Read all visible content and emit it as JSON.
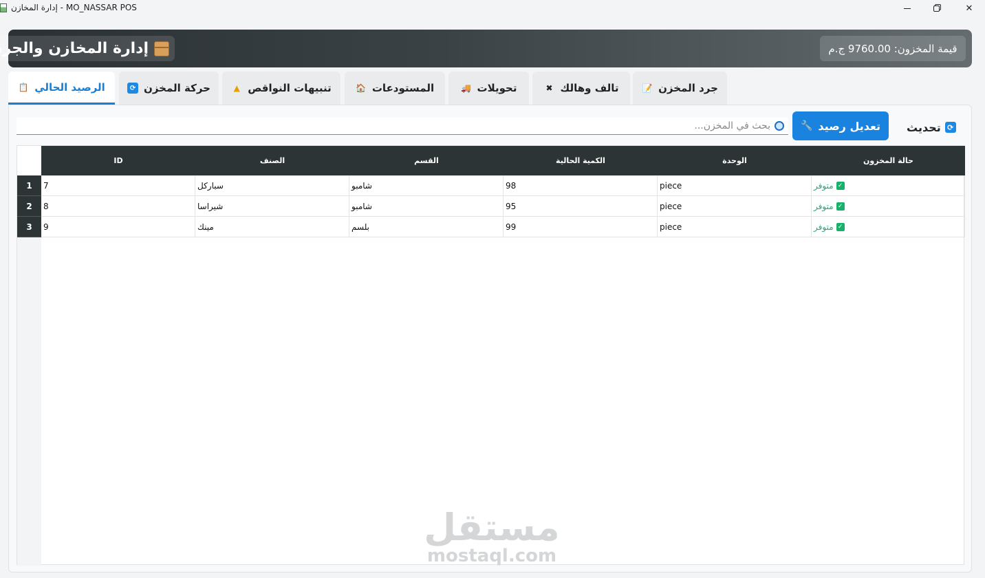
{
  "window": {
    "title": "إدارة المخازن - MO_NASSAR POS"
  },
  "header": {
    "title": "إدارة المخازن والجرد",
    "inventory_value_label": "قيمة المخزون: 9760.00 ج.م"
  },
  "tabs": [
    {
      "label": "جرد المخزن",
      "icon": "clipboard-pen-icon"
    },
    {
      "label": "تالف وهالك",
      "icon": "broken-icon"
    },
    {
      "label": "تحويلات",
      "icon": "truck-icon"
    },
    {
      "label": "المستودعات",
      "icon": "house-icon"
    },
    {
      "label": "تنبيهات النواقص",
      "icon": "warning-icon"
    },
    {
      "label": "حركة المخزن",
      "icon": "refresh-icon"
    },
    {
      "label": "الرصيد الحالي",
      "icon": "clipboard-icon",
      "active": true
    }
  ],
  "toolbar": {
    "refresh_label": "تحديث",
    "adjust_label": "تعديل رصيد",
    "search_placeholder": "بحث في المخزن..."
  },
  "table": {
    "columns": [
      "ID",
      "الصنف",
      "القسم",
      "الكمية الحالية",
      "الوحدة",
      "حالة المخزون"
    ],
    "rows": [
      {
        "num": "1",
        "id": "7",
        "item": "سباركل",
        "category": "شامبو",
        "qty": "98",
        "unit": "piece",
        "status": "متوفر"
      },
      {
        "num": "2",
        "id": "8",
        "item": "شيراسا",
        "category": "شامبو",
        "qty": "95",
        "unit": "piece",
        "status": "متوفر"
      },
      {
        "num": "3",
        "id": "9",
        "item": "مينك",
        "category": "بلسم",
        "qty": "99",
        "unit": "piece",
        "status": "متوفر"
      }
    ]
  },
  "watermark": {
    "arabic": "مستقل",
    "latin": "mostaql.com"
  },
  "colors": {
    "accent": "#1a83e0",
    "header_dark": "#2d3436",
    "status_ok": "#1fa87a"
  }
}
